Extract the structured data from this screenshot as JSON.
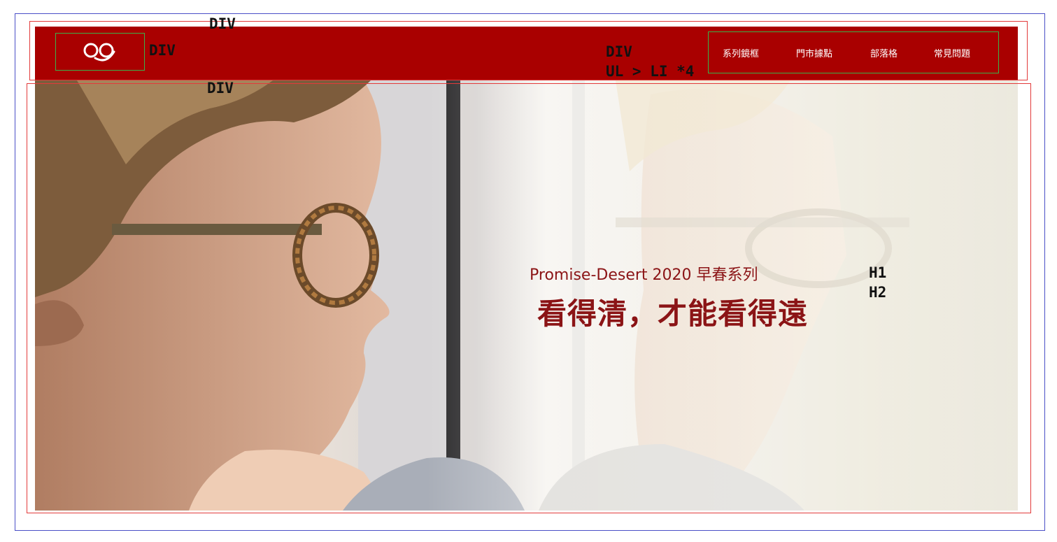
{
  "annotations": {
    "outer_div": "DIV",
    "logo_div": "DIV",
    "nav_div": "DIV",
    "nav_list": "UL > LI *4",
    "hero_div": "DIV",
    "h1_tag": "H1",
    "h2_tag": "H2"
  },
  "header": {
    "background": "#a90000",
    "logo_icon": "glasses-smile-icon",
    "nav_items": [
      "系列鏡框",
      "門市據點",
      "部落格",
      "常見問題"
    ]
  },
  "hero": {
    "image": "man-with-glasses-reflection",
    "h1": "Promise-Desert 2020 早春系列",
    "h2": "看得清，才能看得遠",
    "text_color": "#8b1416"
  },
  "frame_colors": {
    "outer": "#4a4fc7",
    "section": "#e23a3a",
    "box": "#3ab24a"
  }
}
